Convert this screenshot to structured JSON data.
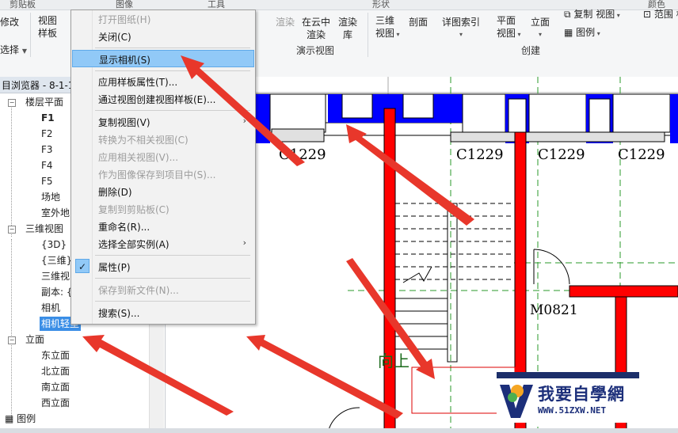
{
  "ribbon": {
    "header_tabs": [
      "剪贴板",
      "图像",
      "工具",
      "形状",
      "颜色"
    ],
    "items": {
      "modify": "修改",
      "select": "选择",
      "view_template": [
        "视图",
        "样板"
      ],
      "render": "渲染",
      "cloud_render": [
        "在云中",
        "渲染"
      ],
      "render_gallery": [
        "渲染",
        "库"
      ],
      "view3d": [
        "三维",
        "视图"
      ],
      "section": "剖面",
      "callout": "详图索引",
      "plan": [
        "平面",
        "视图"
      ],
      "elevation": "立面",
      "duplicate_view": "复制 视图",
      "legend": "图例",
      "scope_box": "范围 框"
    },
    "groups": {
      "presentation": "演示视图",
      "create": "创建"
    }
  },
  "browser": {
    "title": "目浏览器 - 8-1-1",
    "floor_plans": "楼层平面",
    "floors": [
      "F1",
      "F2",
      "F3",
      "F4",
      "F5",
      "场地",
      "室外地"
    ],
    "views_3d": "三维视图",
    "views_3d_items": [
      "{3D}",
      "{三维}",
      "三维视",
      "副本: {",
      "相机",
      "相机轻型"
    ],
    "elevations": "立面",
    "elevation_items": [
      "东立面",
      "北立面",
      "南立面",
      "西立面"
    ],
    "legends": "图例"
  },
  "context_menu": {
    "items": [
      {
        "label": "打开图纸(H)",
        "disabled": true
      },
      {
        "label": "关闭(C)",
        "disabled": false
      },
      {
        "label": "显示相机(S)",
        "disabled": false,
        "highlighted": true
      },
      {
        "label": "应用样板属性(T)...",
        "disabled": false
      },
      {
        "label": "通过视图创建视图样板(E)...",
        "disabled": false
      },
      {
        "label": "复制视图(V)",
        "disabled": false,
        "submenu": true
      },
      {
        "label": "转换为不相关视图(C)",
        "disabled": true
      },
      {
        "label": "应用相关视图(V)...",
        "disabled": true
      },
      {
        "label": "作为图像保存到项目中(S)...",
        "disabled": true
      },
      {
        "label": "删除(D)",
        "disabled": false
      },
      {
        "label": "复制到剪贴板(C)",
        "disabled": true
      },
      {
        "label": "重命名(R)...",
        "disabled": false
      },
      {
        "label": "选择全部实例(A)",
        "disabled": false,
        "submenu": true
      },
      {
        "label": "属性(P)",
        "disabled": false,
        "checked": true
      },
      {
        "label": "保存到新文件(N)...",
        "disabled": true
      },
      {
        "label": "搜索(S)...",
        "disabled": false
      }
    ],
    "submenu_arrow": "›",
    "check_mark": "✓"
  },
  "drawing": {
    "window_labels": [
      "C1229",
      "C1229",
      "C1229",
      "C1229"
    ],
    "door_label": "M0821",
    "stair_label": "向上"
  },
  "logo": {
    "text": "我要自學網",
    "url": "WWW.51ZXW.NET"
  },
  "colors": {
    "arrow": "#e8372b",
    "wall_red": "#ff0000",
    "window_blue": "#0000ff",
    "menu_highlight": "#91c9f7"
  }
}
